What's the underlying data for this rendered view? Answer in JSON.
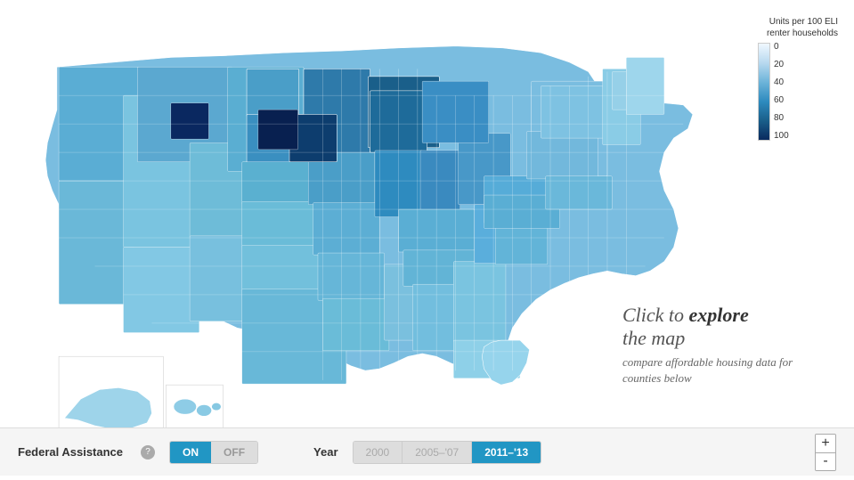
{
  "legend": {
    "title": "Units per 100 ELI renter households",
    "labels": [
      "0",
      "20",
      "40",
      "60",
      "80",
      "100"
    ]
  },
  "overlay": {
    "line1": "Click to ",
    "line1_bold": "explore",
    "line2": "the map",
    "sub": "compare affordable housing data for counties below"
  },
  "controls": {
    "federal_label": "Federal Assistance",
    "info_icon": "?",
    "toggle_on": "ON",
    "toggle_off": "OFF",
    "year_label": "Year",
    "years": [
      "2000",
      "2005–'07",
      "2011–'13"
    ],
    "active_year": "2011–'13",
    "zoom_in": "+",
    "zoom_out": "-"
  }
}
